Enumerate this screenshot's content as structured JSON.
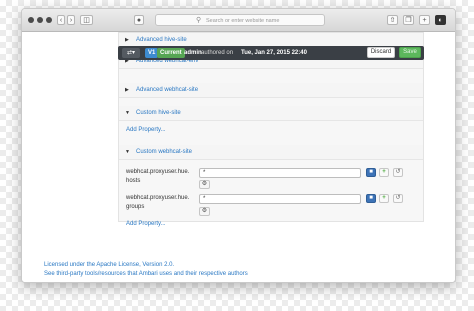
{
  "browser": {
    "url_placeholder": "Search or enter website name"
  },
  "version_bar": {
    "swap_icon": "shuffle-icon",
    "version": "V1",
    "current_badge": "Current",
    "user": "admin",
    "authored_text": "authored on",
    "date": "Tue, Jan 27, 2015 22:40",
    "discard_label": "Discard",
    "save_label": "Save"
  },
  "sections": [
    {
      "title": "Advanced hive-site",
      "expanded": false
    },
    {
      "title": "Advanced webhcat-env",
      "expanded": false
    },
    {
      "title": "Advanced webhcat-site",
      "expanded": false
    },
    {
      "title": "Custom hive-site",
      "expanded": true
    },
    {
      "title": "Custom webhcat-site",
      "expanded": true
    }
  ],
  "custom_hive_site": {
    "add_property": "Add Property..."
  },
  "custom_webhcat_site": {
    "properties": [
      {
        "name_line1": "webhcat.proxyuser.hue.",
        "name_line2": "hosts",
        "value": "*"
      },
      {
        "name_line1": "webhcat.proxyuser.hue.",
        "name_line2": "groups",
        "value": "*"
      }
    ],
    "add_property": "Add Property..."
  },
  "footer": {
    "license": "Licensed under the Apache License, Version 2.0.",
    "third_party": "See third-party tools/resources that Ambari uses and their respective authors"
  }
}
